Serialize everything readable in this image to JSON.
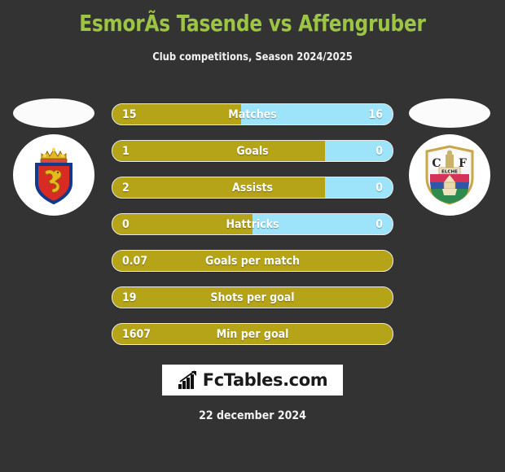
{
  "header": {
    "title": "EsmorÃs Tasende vs Affengruber",
    "subtitle": "Club competitions, Season 2024/2025"
  },
  "colors": {
    "background": "#333333",
    "title_green": "#9dc544",
    "bar_gold": "#b5a318",
    "bar_blue": "#9de4fb",
    "text_white": "#ffffff"
  },
  "teams": {
    "left": {
      "name": "Real Zaragoza",
      "badge_icon": "real-zaragoza-crest"
    },
    "right": {
      "name": "Elche CF",
      "badge_icon": "elche-cf-crest",
      "badge_text": "ELCHE",
      "badge_initial_left": "C",
      "badge_initial_right": "F"
    }
  },
  "chart_data": {
    "type": "bar",
    "title": "EsmorÃs Tasende vs Affengruber",
    "subtitle": "Club competitions, Season 2024/2025",
    "orientation": "horizontal-split",
    "categories": [
      "Matches",
      "Goals",
      "Assists",
      "Hattricks",
      "Goals per match",
      "Shots per goal",
      "Min per goal"
    ],
    "series": [
      {
        "name": "EsmorÃs Tasende",
        "color": "#b5a318",
        "values": [
          "15",
          "1",
          "2",
          "0",
          "0.07",
          "19",
          "1607"
        ]
      },
      {
        "name": "Affengruber",
        "color": "#9de4fb",
        "values": [
          "16",
          "0",
          "0",
          "0",
          "",
          "",
          ""
        ]
      }
    ]
  },
  "stats": [
    {
      "label": "Matches",
      "left": "15",
      "right": "16",
      "fill_pct": 46,
      "split": true
    },
    {
      "label": "Goals",
      "left": "1",
      "right": "0",
      "fill_pct": 76,
      "split": true
    },
    {
      "label": "Assists",
      "left": "2",
      "right": "0",
      "fill_pct": 76,
      "split": true
    },
    {
      "label": "Hattricks",
      "left": "0",
      "right": "0",
      "fill_pct": 50,
      "split": true
    },
    {
      "label": "Goals per match",
      "left": "0.07",
      "right": "",
      "fill_pct": 100,
      "split": false
    },
    {
      "label": "Shots per goal",
      "left": "19",
      "right": "",
      "fill_pct": 100,
      "split": false
    },
    {
      "label": "Min per goal",
      "left": "1607",
      "right": "",
      "fill_pct": 100,
      "split": false
    }
  ],
  "footer": {
    "logo_text": "FcTables.com",
    "logo_icon": "bar-chart-arrow-icon",
    "date": "22 december 2024"
  }
}
